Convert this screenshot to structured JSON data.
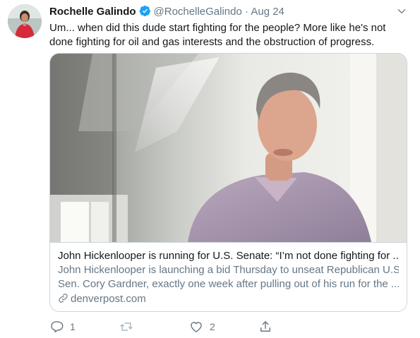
{
  "tweet": {
    "author_name": "Rochelle Galindo",
    "handle": "@RochelleGalindo",
    "separator": "·",
    "date": "Aug 24",
    "text": "Um... when did this dude start fighting for the people? More like he's not done fighting for oil and gas interests and the obstruction of progress."
  },
  "card": {
    "title": "John Hickenlooper is running for U.S. Senate: “I’m not done fighting for ...",
    "description_line1": "John Hickenlooper is launching a bid Thursday to unseat Republican U.S.",
    "description_line2": "Sen. Cory Gardner, exactly one week after pulling out of his run for the ...",
    "domain": "denverpost.com"
  },
  "actions": {
    "reply_count": "1",
    "retweet_count": "",
    "like_count": "2"
  },
  "icons": [
    "verified-badge-icon",
    "chevron-down-icon",
    "link-icon",
    "reply-icon",
    "retweet-icon",
    "like-icon",
    "share-icon"
  ],
  "colors": {
    "accent": "#1da1f2",
    "secondary_text": "#657786",
    "border": "#ccd6dd"
  }
}
